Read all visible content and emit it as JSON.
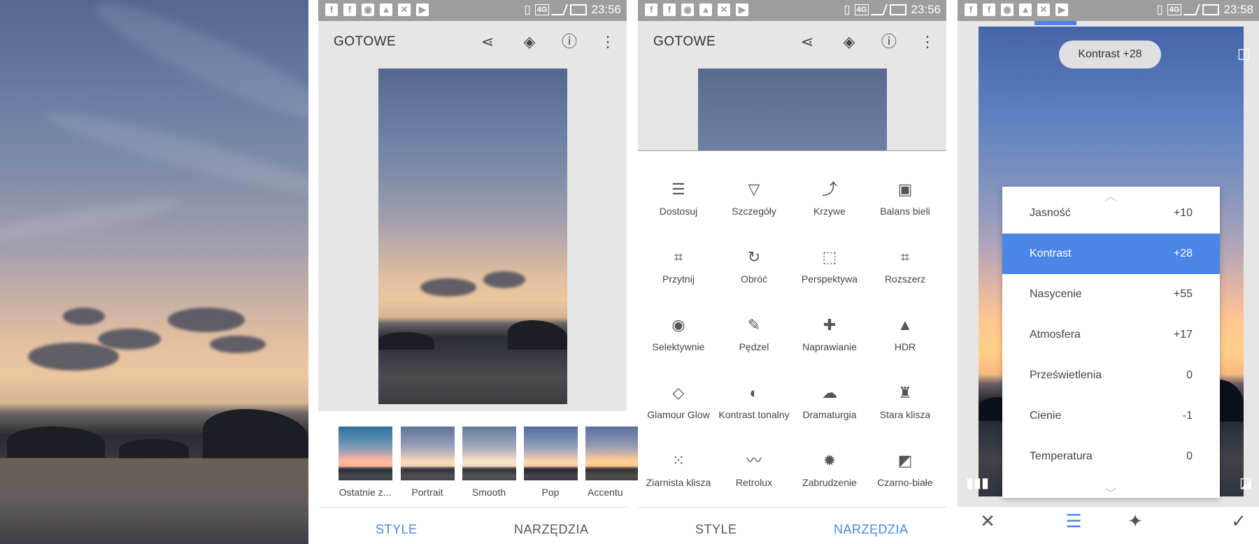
{
  "status": {
    "time1": "23:56",
    "time2": "23:56",
    "time3": "23:58",
    "network": "4G"
  },
  "panel2": {
    "done_label": "GOTOWE",
    "styles": [
      "Ostatnie z...",
      "Portrait",
      "Smooth",
      "Pop",
      "Accentu"
    ]
  },
  "panel3": {
    "done_label": "GOTOWE",
    "tools": [
      {
        "label": "Dostosuj",
        "icon": "adjust-sliders-icon"
      },
      {
        "label": "Szczegóły",
        "icon": "details-triangle-icon"
      },
      {
        "label": "Krzywe",
        "icon": "curves-icon"
      },
      {
        "label": "Balans bieli",
        "icon": "white-balance-icon"
      },
      {
        "label": "Przytnij",
        "icon": "crop-icon"
      },
      {
        "label": "Obróć",
        "icon": "rotate-icon"
      },
      {
        "label": "Perspektywa",
        "icon": "perspective-icon"
      },
      {
        "label": "Rozszerz",
        "icon": "expand-icon"
      },
      {
        "label": "Selektywnie",
        "icon": "selective-icon"
      },
      {
        "label": "Pędzel",
        "icon": "brush-icon"
      },
      {
        "label": "Naprawianie",
        "icon": "healing-icon"
      },
      {
        "label": "HDR",
        "icon": "hdr-icon"
      },
      {
        "label": "Glamour Glow",
        "icon": "glamour-glow-icon"
      },
      {
        "label": "Kontrast tonalny",
        "icon": "tonal-contrast-icon"
      },
      {
        "label": "Dramaturgia",
        "icon": "drama-icon"
      },
      {
        "label": "Stara klisza",
        "icon": "vintage-icon"
      },
      {
        "label": "Ziarnista klisza",
        "icon": "grainy-film-icon"
      },
      {
        "label": "Retrolux",
        "icon": "retrolux-icon"
      },
      {
        "label": "Zabrudzenie",
        "icon": "grunge-icon"
      },
      {
        "label": "Czarno-białe",
        "icon": "black-white-icon"
      }
    ]
  },
  "tabs": {
    "style": "STYLE",
    "tools": "NARZĘDZIA"
  },
  "panel4": {
    "pill": "Kontrast +28",
    "rows": [
      {
        "name": "Jasność",
        "value": "+10",
        "selected": false
      },
      {
        "name": "Kontrast",
        "value": "+28",
        "selected": true
      },
      {
        "name": "Nasycenie",
        "value": "+55",
        "selected": false
      },
      {
        "name": "Atmosfera",
        "value": "+17",
        "selected": false
      },
      {
        "name": "Prześwietlenia",
        "value": "0",
        "selected": false
      },
      {
        "name": "Cienie",
        "value": "-1",
        "selected": false
      },
      {
        "name": "Temperatura",
        "value": "0",
        "selected": false
      }
    ]
  },
  "colors": {
    "accent": "#4a86e8",
    "bar_gray": "#9e9e9e",
    "panel_gray": "#e6e6e6"
  }
}
